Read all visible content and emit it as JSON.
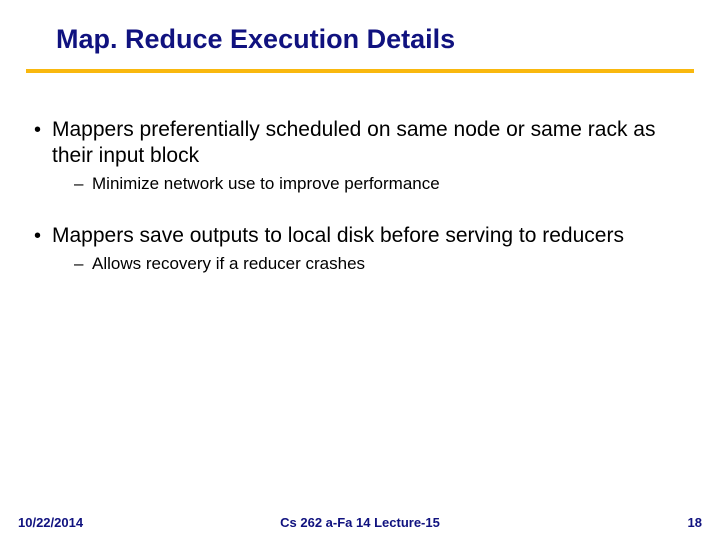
{
  "title": "Map. Reduce Execution Details",
  "bullets": [
    {
      "text": "Mappers preferentially scheduled on same node or same rack as their input block",
      "sub": [
        "Minimize network use to improve performance"
      ]
    },
    {
      "text": "Mappers save outputs to local disk before serving to reducers",
      "sub": [
        "Allows recovery if a reducer crashes"
      ]
    }
  ],
  "footer": {
    "date": "10/22/2014",
    "center": "Cs 262 a-Fa 14 Lecture-15",
    "page": "18"
  },
  "markers": {
    "l1": "•",
    "l2": "–"
  }
}
